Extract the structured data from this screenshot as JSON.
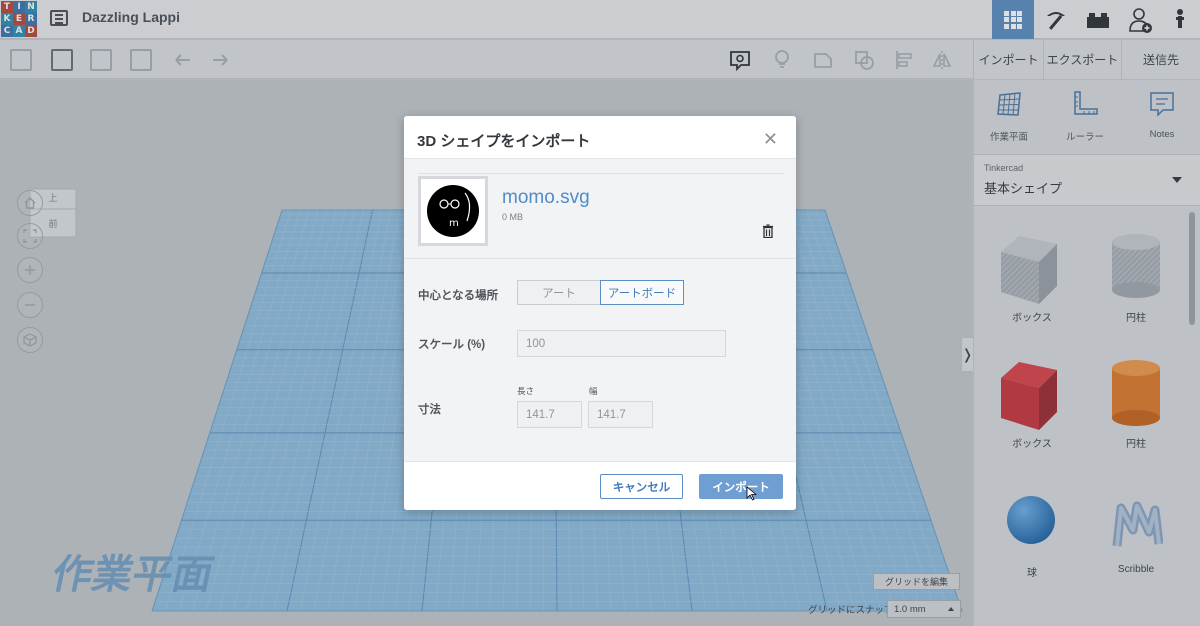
{
  "app": {
    "logo_letters": [
      "T",
      "I",
      "N",
      "K",
      "E",
      "R",
      "C",
      "A",
      "D"
    ],
    "design_title": "Dazzling Lappi"
  },
  "toolbar": {
    "import_label": "インポート",
    "export_label": "エクスポート",
    "send_label": "送信先"
  },
  "viewcube": {
    "top": "上",
    "front": "前"
  },
  "workplane": {
    "watermark": "作業平面"
  },
  "right_panel": {
    "tools": [
      {
        "label": "作業平面",
        "icon": "workplane-icon"
      },
      {
        "label": "ルーラー",
        "icon": "ruler-icon"
      },
      {
        "label": "Notes",
        "icon": "notes-icon"
      }
    ],
    "library_source": "Tinkercad",
    "library_category": "基本シェイプ",
    "shapes": [
      {
        "label": "ボックス",
        "icon": "box-hole-icon"
      },
      {
        "label": "円柱",
        "icon": "cylinder-hole-icon"
      },
      {
        "label": "ボックス",
        "icon": "box-icon"
      },
      {
        "label": "円柱",
        "icon": "cylinder-icon"
      },
      {
        "label": "球",
        "icon": "sphere-icon"
      },
      {
        "label": "Scribble",
        "icon": "scribble-icon"
      }
    ]
  },
  "bottom": {
    "edit_grid_label": "グリッドを編集",
    "snap_label": "グリッドにスナップ",
    "snap_value": "1.0 mm"
  },
  "modal": {
    "title": "3D シェイプをインポート",
    "file_name": "momo.svg",
    "file_size": "0 MB",
    "center_label": "中心となる場所",
    "center_options": [
      "アート",
      "アートボード"
    ],
    "center_selected": "アートボード",
    "scale_label": "スケール (%)",
    "scale_value": "100",
    "dimensions_label": "寸法",
    "length_label": "長さ",
    "width_label": "幅",
    "length_value": "141.7",
    "width_value": "141.7",
    "cancel_label": "キャンセル",
    "import_label": "インポート"
  },
  "colors": {
    "accent": "#5b8ec2",
    "link": "#4f8cc9",
    "grid": "#7fb0d6",
    "red_shape": "#c8353d",
    "orange_shape": "#e07a2c",
    "blue_shape": "#2f7fc6"
  }
}
